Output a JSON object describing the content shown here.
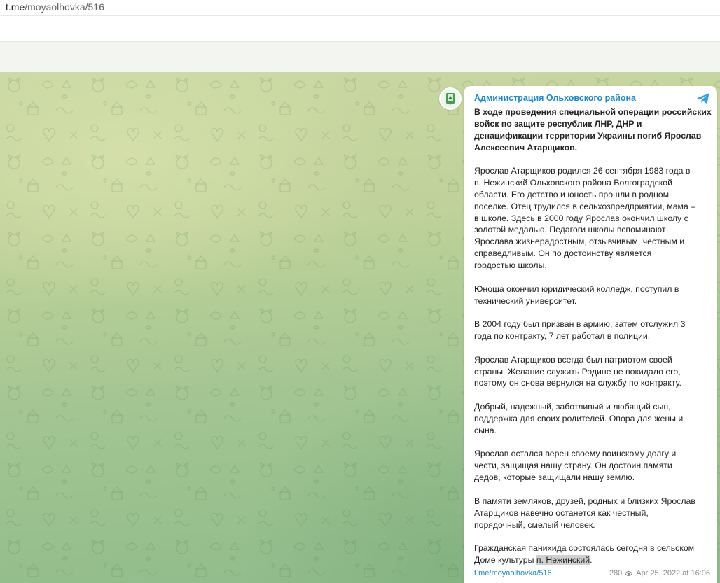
{
  "browser": {
    "url_host": "t.me",
    "url_path": "/moyaolhovka/516"
  },
  "colors": {
    "link": "#168acd",
    "text": "#222222",
    "meta": "#8a8a8a",
    "bubble": "#ffffff",
    "highlight": "#d0d0d0"
  },
  "post": {
    "channel_name": "Администрация Ольховского района",
    "avatar_icon": "district-emblem-icon",
    "platform_icon": "telegram-icon",
    "lead_lines": [
      "В ходе проведения специальной операции российских",
      "войск по защите республик ЛНР, ДНР и",
      "денацификации территории Украины погиб Ярослав",
      "Алексеевич Атарщиков."
    ],
    "p1_lines": [
      "Ярослав Атарщиков родился 26 сентября 1983 года в",
      "п. Нежинский Ольховского района Волгоградской",
      "области. Его детство и юность прошли в родном",
      "поселке. Отец трудился в сельхозпредприятии, мама –",
      "в школе. Здесь в 2000 году Ярослав окончил школу с",
      "золотой медалью. Педагоги школы вспоминают",
      "Ярослава жизнерадостным, отзывчивым, честным и",
      "справедливым. Он по достоинству является",
      "гордостью школы."
    ],
    "p2_lines": [
      "Юноша окончил юридический колледж, поступил в",
      "технический университет."
    ],
    "p3_lines": [
      "В 2004 году был призван в армию, затем отслужил 3",
      "года по контракту, 7 лет работал в полиции."
    ],
    "p4_lines": [
      "Ярослав Атарщиков всегда был патриотом своей",
      "страны. Желание служить Родине не покидало его,",
      "поэтому он снова вернулся на службу по контракту."
    ],
    "p5_lines": [
      "Добрый, надежный, заботливый и любящий сын,",
      "поддержка для своих родителей. Опора для жены и",
      "сына."
    ],
    "p6_lines": [
      "Ярослав остался верен своему воинскому долгу и",
      "чести, защищая нашу страну. Он достоин памяти",
      "дедов, которые защищали нашу землю."
    ],
    "p7_lines": [
      "В памяти земляков, друзей, родных и близких Ярослав",
      "Атарщиков навечно останется как честный,",
      "порядочный, смелый человек."
    ],
    "p8_line1": "Гражданская панихида состоялась сегодня в сельском",
    "p8_line2_before": "Доме культуры ",
    "p8_line2_highlight": "п. Нежинский",
    "p8_line2_after": ".",
    "footer": {
      "link": "t.me/moyaolhovka/516",
      "views": "280",
      "views_icon": "eye-icon",
      "date": "Apr 25, 2022 at 16:06"
    }
  }
}
